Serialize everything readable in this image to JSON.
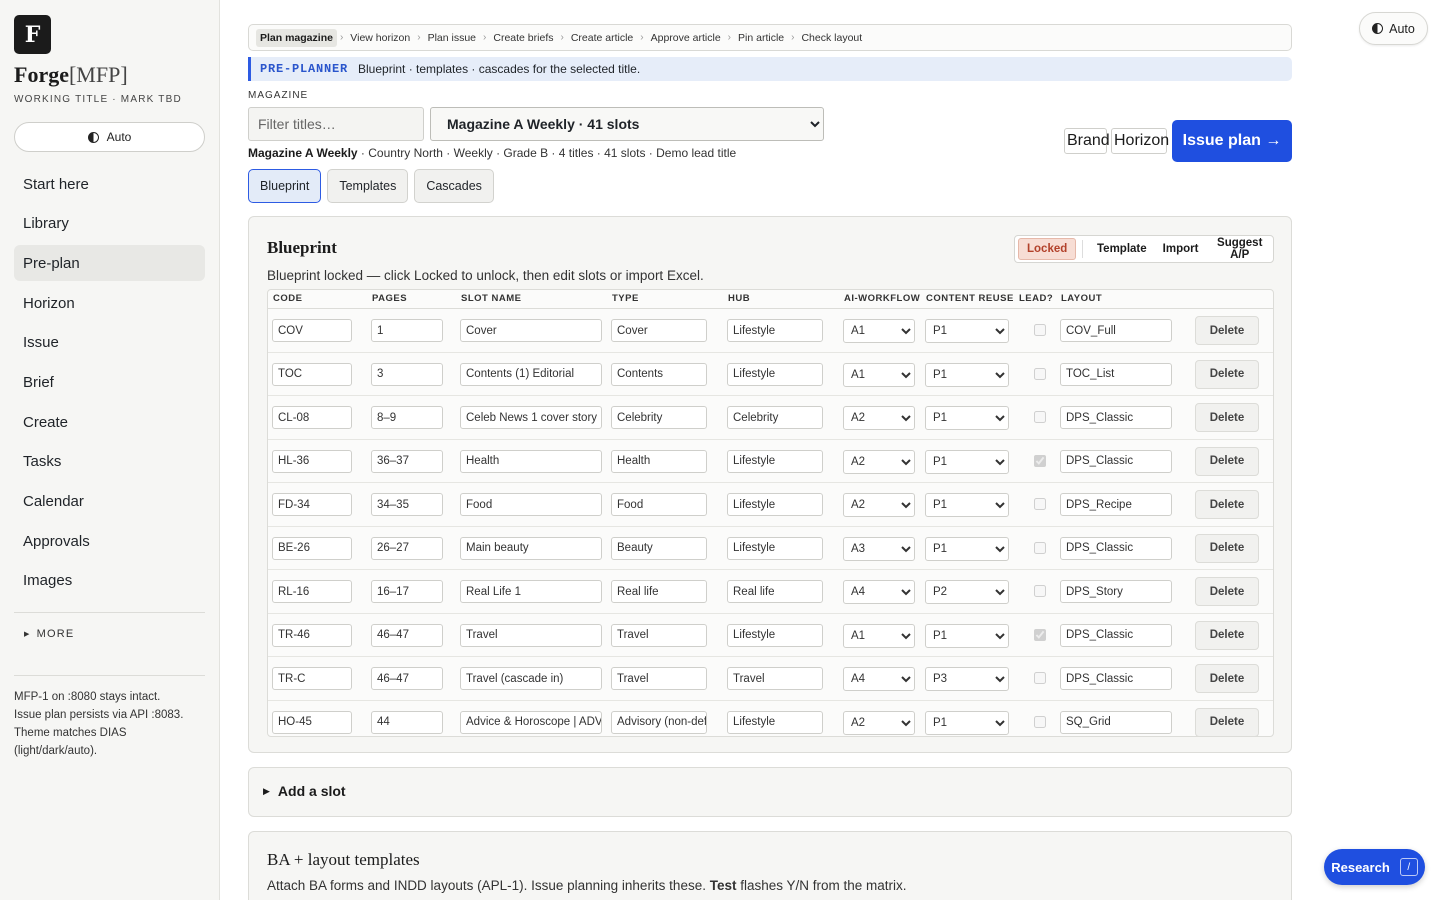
{
  "sidebar": {
    "logo_letter": "F",
    "brand_bold": "Forge",
    "brand_light": "[MFP]",
    "subtitle": "WORKING TITLE · MARK TBD",
    "theme_label": "Auto",
    "nav": [
      {
        "label": "Start here",
        "active": false
      },
      {
        "label": "Library",
        "active": false
      },
      {
        "label": "Pre-plan",
        "active": true
      },
      {
        "label": "Horizon",
        "active": false
      },
      {
        "label": "Issue",
        "active": false
      },
      {
        "label": "Brief",
        "active": false
      },
      {
        "label": "Create",
        "active": false
      },
      {
        "label": "Tasks",
        "active": false
      },
      {
        "label": "Calendar",
        "active": false
      },
      {
        "label": "Approvals",
        "active": false
      },
      {
        "label": "Images",
        "active": false
      }
    ],
    "more_label": "MORE",
    "footer_lines": [
      "MFP-1 on :8080 stays intact.",
      "Issue plan persists via API :8083.",
      "Theme matches DIAS",
      "(light/dark/auto)."
    ]
  },
  "top_theme_label": "Auto",
  "breadcrumb": [
    "Plan magazine",
    "View horizon",
    "Plan issue",
    "Create briefs",
    "Create article",
    "Approve article",
    "Pin article",
    "Check layout"
  ],
  "preplanner": {
    "tag": "PRE-PLANNER",
    "text": "Blueprint · templates · cascades for the selected title."
  },
  "magazine": {
    "label": "MAGAZINE",
    "filter_placeholder": "Filter titles…",
    "selected": "Magazine A Weekly · 41 slots",
    "meta_bold": "Magazine A Weekly",
    "meta_rest": " · Country North · Weekly · Grade B · 4 titles · 41 slots · Demo lead title"
  },
  "header_buttons": {
    "brand": "Brand",
    "horizon": "Horizon",
    "issue_plan": "Issue plan →"
  },
  "tabs": [
    {
      "label": "Blueprint",
      "active": true
    },
    {
      "label": "Templates",
      "active": false
    },
    {
      "label": "Cascades",
      "active": false
    }
  ],
  "blueprint": {
    "title": "Blueprint",
    "actions": {
      "locked": "Locked",
      "template": "Template",
      "import": "Import",
      "suggest": "Suggest A/P"
    },
    "note": "Blueprint locked — click Locked to unlock, then edit slots or import Excel.",
    "columns": [
      "CODE",
      "PAGES",
      "SLOT NAME",
      "TYPE",
      "HUB",
      "AI-WORKFLOW",
      "CONTENT REUSE",
      "LEAD?",
      "LAYOUT"
    ],
    "delete_label": "Delete",
    "rows": [
      {
        "code": "COV",
        "pages": "1",
        "slot": "Cover",
        "type": "Cover",
        "hub": "Lifestyle",
        "ai": "A1",
        "reuse": "P1",
        "lead": false,
        "layout": "COV_Full"
      },
      {
        "code": "TOC",
        "pages": "3",
        "slot": "Contents (1) Editorial",
        "type": "Contents",
        "hub": "Lifestyle",
        "ai": "A1",
        "reuse": "P1",
        "lead": false,
        "layout": "TOC_List"
      },
      {
        "code": "CL-08",
        "pages": "8–9",
        "slot": "Celeb News 1 cover story",
        "type": "Celebrity",
        "hub": "Celebrity",
        "ai": "A2",
        "reuse": "P1",
        "lead": false,
        "layout": "DPS_Classic"
      },
      {
        "code": "HL-36",
        "pages": "36–37",
        "slot": "Health",
        "type": "Health",
        "hub": "Lifestyle",
        "ai": "A2",
        "reuse": "P1",
        "lead": true,
        "layout": "DPS_Classic"
      },
      {
        "code": "FD-34",
        "pages": "34–35",
        "slot": "Food",
        "type": "Food",
        "hub": "Lifestyle",
        "ai": "A2",
        "reuse": "P1",
        "lead": false,
        "layout": "DPS_Recipe"
      },
      {
        "code": "BE-26",
        "pages": "26–27",
        "slot": "Main beauty",
        "type": "Beauty",
        "hub": "Lifestyle",
        "ai": "A3",
        "reuse": "P1",
        "lead": false,
        "layout": "DPS_Classic"
      },
      {
        "code": "RL-16",
        "pages": "16–17",
        "slot": "Real Life 1",
        "type": "Real life",
        "hub": "Real life",
        "ai": "A4",
        "reuse": "P2",
        "lead": false,
        "layout": "DPS_Story"
      },
      {
        "code": "TR-46",
        "pages": "46–47",
        "slot": "Travel",
        "type": "Travel",
        "hub": "Lifestyle",
        "ai": "A1",
        "reuse": "P1",
        "lead": true,
        "layout": "DPS_Classic"
      },
      {
        "code": "TR-C",
        "pages": "46–47",
        "slot": "Travel (cascade in)",
        "type": "Travel",
        "hub": "Travel",
        "ai": "A4",
        "reuse": "P3",
        "lead": false,
        "layout": "DPS_Classic"
      },
      {
        "code": "HO-45",
        "pages": "44",
        "slot": "Advice & Horoscope | ADVICE",
        "type": "Advisory (non-def",
        "hub": "Lifestyle",
        "ai": "A2",
        "reuse": "P1",
        "lead": false,
        "layout": "SQ_Grid"
      }
    ]
  },
  "add_slot_label": "Add a slot",
  "templates_section": {
    "title": "BA + layout templates",
    "desc_before": "Attach BA forms and INDD layouts (APL-1). Issue planning inherits these. ",
    "desc_bold": "Test",
    "desc_after": " flashes Y/N from the matrix."
  },
  "research": {
    "label": "Research",
    "shortcut": "/"
  },
  "colors": {
    "accent": "#1f4fe0",
    "locked": "#b2412a",
    "preplanner_bg": "#e6edf9"
  }
}
